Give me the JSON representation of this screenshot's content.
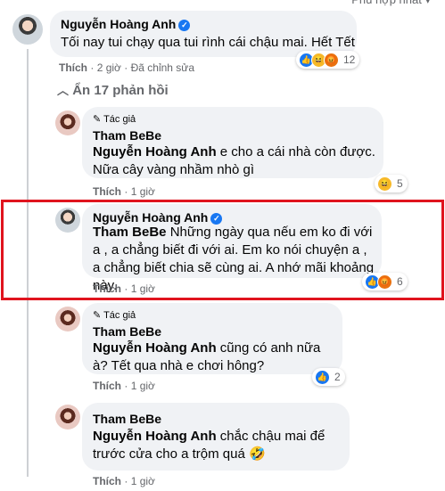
{
  "header": {
    "cutoff_text": "Phù hợp nhất ▾"
  },
  "comments": [
    {
      "name": "Nguyễn Hoàng Anh",
      "text": "Tối nay tui chạy qua tui rình cái chậu mai. Hết Tết",
      "like": "Thích",
      "time": "2 giờ",
      "edited": "Đã chỉnh sửa",
      "reaction_count": "12"
    }
  ],
  "hide_replies": "Ẩn 17 phản hồi",
  "replies": [
    {
      "author_badge": "Tác giả",
      "name": "Tham BeBe",
      "mention": "Nguyễn Hoàng Anh",
      "text": " e cho a cái nhà còn được. Nữa cây vàng nhầm nhò gì",
      "like": "Thích",
      "time": "1 giờ",
      "reaction_count": "5"
    },
    {
      "name": "Nguyễn Hoàng Anh",
      "mention": "Tham BeBe",
      "text": " Những ngày qua nếu em ko đi với a , a chẳng biết đi với ai. Em ko nói chuyện a , a chẳng biết chia sẽ cùng ai. A nhớ mãi khoảng này.",
      "like": "Thích",
      "time": "1 giờ",
      "reaction_count": "6"
    },
    {
      "author_badge": "Tác giả",
      "name": "Tham BeBe",
      "mention": "Nguyễn Hoàng Anh",
      "text": " cũng có anh nữa à? Tết qua nhà e chơi hông?",
      "like": "Thích",
      "time": "1 giờ",
      "reaction_count": "2"
    },
    {
      "name": "Tham BeBe",
      "mention": "Nguyễn Hoàng Anh",
      "text": " chắc chậu mai để trước cửa cho a trộm quá 🤣",
      "like": "Thích",
      "time": "1 giờ"
    }
  ],
  "dot": "·"
}
